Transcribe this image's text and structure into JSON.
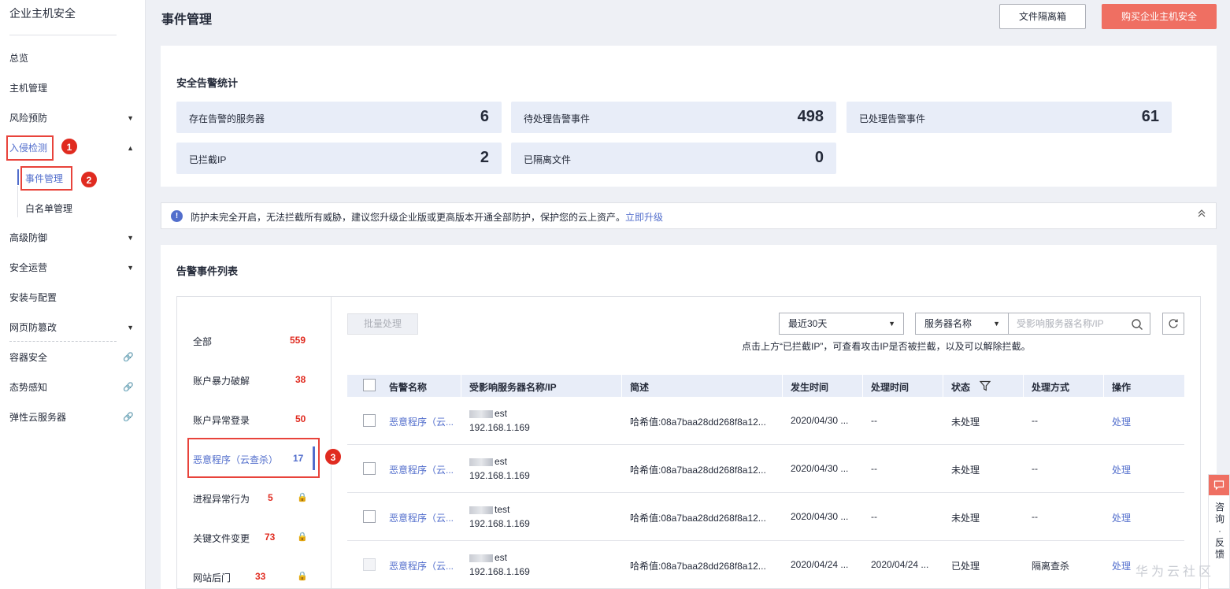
{
  "sidebar": {
    "brand": "企业主机安全",
    "items": [
      {
        "label": "总览"
      },
      {
        "label": "主机管理"
      },
      {
        "label": "风险预防"
      },
      {
        "label": "入侵检测"
      },
      {
        "label": "事件管理"
      },
      {
        "label": "白名单管理"
      },
      {
        "label": "高级防御"
      },
      {
        "label": "安全运营"
      },
      {
        "label": "安装与配置"
      },
      {
        "label": "网页防篡改"
      },
      {
        "label": "容器安全"
      },
      {
        "label": "态势感知"
      },
      {
        "label": "弹性云服务器"
      }
    ],
    "callouts": [
      "1",
      "2",
      "3"
    ]
  },
  "header": {
    "title": "事件管理",
    "quarantine_button": "文件隔离箱",
    "buy_button": "购买企业主机安全"
  },
  "stats": {
    "title": "安全告警统计",
    "items": [
      {
        "label": "存在告警的服务器",
        "value": "6"
      },
      {
        "label": "待处理告警事件",
        "value": "498"
      },
      {
        "label": "已处理告警事件",
        "value": "61"
      },
      {
        "label": "已拦截IP",
        "value": "2"
      },
      {
        "label": "已隔离文件",
        "value": "0"
      }
    ]
  },
  "notice": {
    "text": "防护未完全开启，无法拦截所有威胁，建议您升级企业版或更高版本开通全部防护，保护您的云上资产。",
    "link": "立即升级"
  },
  "events": {
    "title": "告警事件列表",
    "categories": [
      {
        "label": "全部",
        "count": "559"
      },
      {
        "label": "账户暴力破解",
        "count": "38"
      },
      {
        "label": "账户异常登录",
        "count": "50"
      },
      {
        "label": "恶意程序（云查杀）",
        "count": "17"
      },
      {
        "label": "进程异常行为",
        "count": "5"
      },
      {
        "label": "关键文件变更",
        "count": "73"
      },
      {
        "label": "网站后门",
        "count": "33"
      }
    ],
    "toolbar": {
      "batch_button": "批量处理",
      "time_select": "最近30天",
      "field_select": "服务器名称",
      "search_placeholder": "受影响服务器名称/IP",
      "hint": "点击上方“已拦截IP”，可查看攻击IP是否被拦截，以及可以解除拦截。"
    },
    "columns": [
      "告警名称",
      "受影响服务器名称/IP",
      "简述",
      "发生时间",
      "处理时间",
      "状态",
      "处理方式",
      "操作"
    ],
    "rows": [
      {
        "name": "恶意程序（云...",
        "server": "est",
        "ip": "192.168.1.169",
        "desc": "哈希值:08a7baa28dd268f8a12...",
        "time": "2020/04/30 ...",
        "handled": "--",
        "status": "未处理",
        "method": "--",
        "action": "处理"
      },
      {
        "name": "恶意程序（云...",
        "server": "est",
        "ip": "192.168.1.169",
        "desc": "哈希值:08a7baa28dd268f8a12...",
        "time": "2020/04/30 ...",
        "handled": "--",
        "status": "未处理",
        "method": "--",
        "action": "处理"
      },
      {
        "name": "恶意程序（云...",
        "server": "test",
        "ip": "192.168.1.169",
        "desc": "哈希值:08a7baa28dd268f8a12...",
        "time": "2020/04/30 ...",
        "handled": "--",
        "status": "未处理",
        "method": "--",
        "action": "处理"
      },
      {
        "name": "恶意程序（云...",
        "server": "est",
        "ip": "192.168.1.169",
        "desc": "哈希值:08a7baa28dd268f8a12...",
        "time": "2020/04/24 ...",
        "handled": "2020/04/24 ...",
        "status": "已处理",
        "method": "隔离查杀",
        "action": "处理"
      }
    ]
  },
  "floating": {
    "consult": "咨询·反馈",
    "watermark": "华为云社区"
  }
}
